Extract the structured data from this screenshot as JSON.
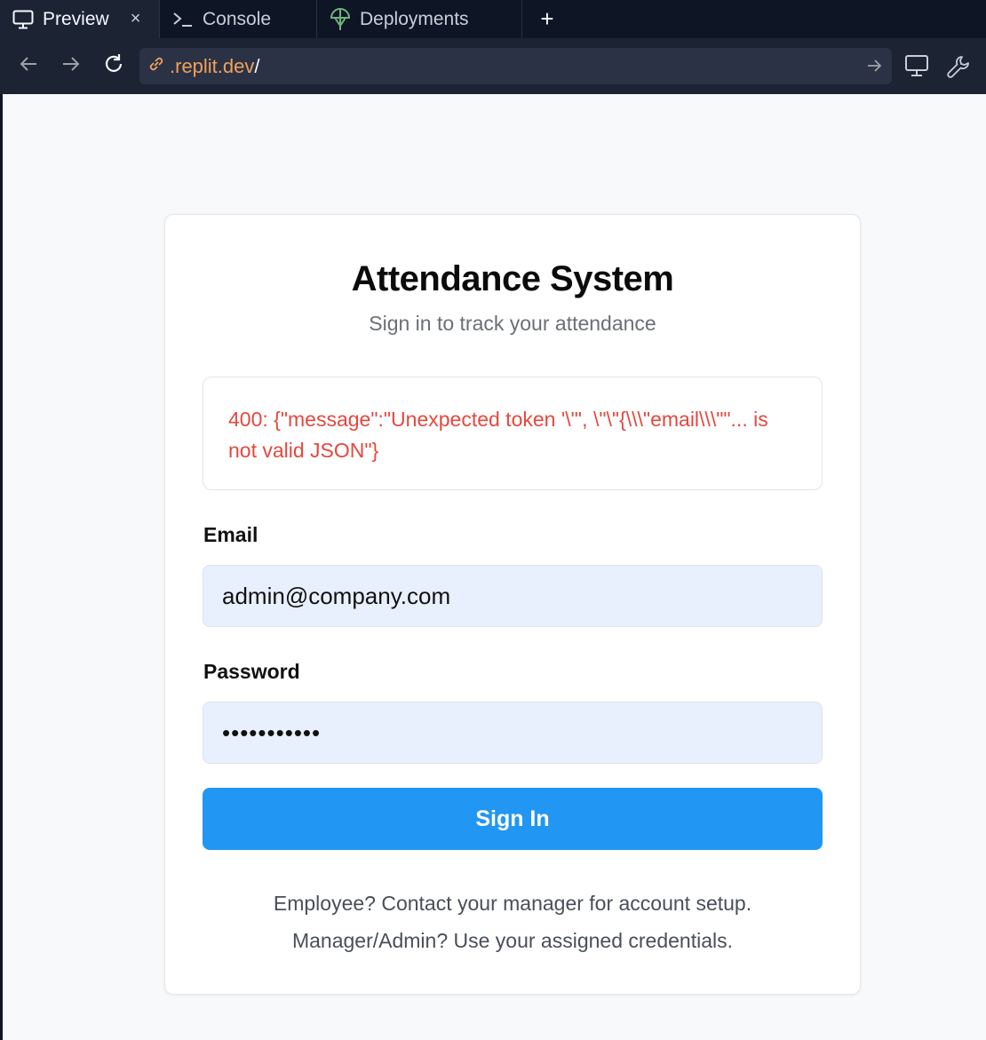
{
  "tabs": [
    {
      "label": "Preview",
      "icon": "monitor-icon",
      "active": true
    },
    {
      "label": "Console",
      "icon": "terminal-icon",
      "active": false
    },
    {
      "label": "Deployments",
      "icon": "deployments-icon",
      "active": false
    }
  ],
  "tab_add_symbol": "+",
  "tab_close_symbol": "×",
  "address": {
    "host": ".replit.dev",
    "path": "/"
  },
  "page": {
    "title": "Attendance System",
    "subtitle": "Sign in to track your attendance",
    "error_message": "400: {\"message\":\"Unexpected token '\\\"', \\\"\\\"{\\\\\\\"email\\\\\\\"\"... is not valid JSON\"}",
    "email_label": "Email",
    "email_value": "admin@company.com",
    "password_label": "Password",
    "password_masked": "•••••••••••",
    "signin_label": "Sign In",
    "help_line_1": "Employee? Contact your manager for account setup.",
    "help_line_2": "Manager/Admin? Use your assigned credentials."
  },
  "colors": {
    "accent": "#2196f3",
    "error": "#e5483e",
    "url_host": "#f0a15a",
    "input_bg": "#e8f0fe"
  }
}
